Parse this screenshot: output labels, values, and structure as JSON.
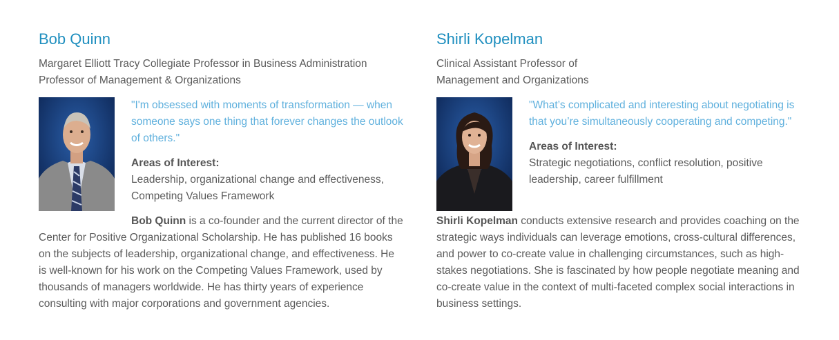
{
  "profiles": [
    {
      "name": "Bob Quinn",
      "title_line1": "Margaret Elliott Tracy Collegiate Professor in Business Administration",
      "title_line2": "Professor of Management & Organizations",
      "quote": "\"I'm obsessed with moments of transformation — when someone says one thing that forever changes the outlook of others.\"",
      "areas_heading": "Areas of Interest:",
      "areas_text": "Leadership, organizational change and effectiveness, Competing Values Framework",
      "bio_name": "Bob Quinn",
      "bio_text": " is a co-founder and the current director of the Center for Positive Organizational Scholarship. He has published 16 books on the subjects of leadership, organizational change, and effectiveness. He is well-known for his work on the Competing Values Framework, used by thousands of managers worldwide. He has thirty years of experience consulting with major corporations and government agencies."
    },
    {
      "name": "Shirli Kopelman",
      "title_line1": "Clinical Assistant Professor of",
      "title_line2": "Management and Organizations",
      "quote": "\"What’s complicated and interesting about negotiating is that you’re simultaneously cooperating and competing.\"",
      "areas_heading": "Areas of Interest:",
      "areas_text": "Strategic negotiations, conflict resolution, positive leadership, career fulfillment",
      "bio_name": "Shirli Kopelman",
      "bio_text": " conducts extensive research and provides coaching on the strategic ways individuals can leverage emotions, cross-cultural differences, and power to co-create value in challenging circumstances, such as high-stakes negotiations. She is fascinated by how people negotiate meaning and co-create value in the context of multi-faceted complex social interactions in business settings."
    }
  ],
  "colors": {
    "name": "#1f8fbf",
    "quote": "#5fb0dd",
    "body_text": "#5a5a5a",
    "photo_bg": "#0f2f5c"
  }
}
